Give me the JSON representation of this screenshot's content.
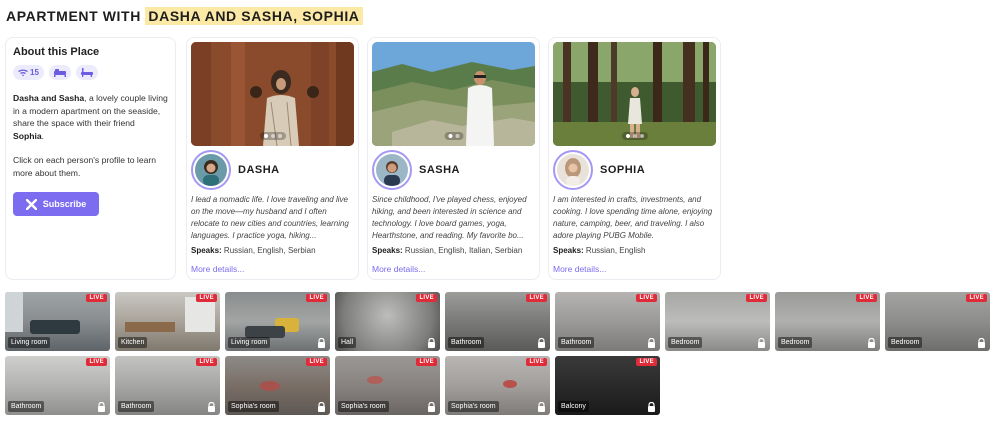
{
  "header": {
    "title_prefix": "APARTMENT WITH",
    "title_highlight": "DASHA AND SASHA, SOPHIA"
  },
  "about": {
    "heading": "About this Place",
    "amenities": [
      {
        "icon": "wifi-icon",
        "value": "15"
      },
      {
        "icon": "bed-icon",
        "value": ""
      },
      {
        "icon": "bathtub-icon",
        "value": ""
      }
    ],
    "desc_bold1": "Dasha and Sasha",
    "desc_mid": ", a lovely couple living in a modern apartment on the seaside, share the space with their friend ",
    "desc_bold2": "Sophia",
    "desc_end": ".",
    "hint": "Click on each person's profile to learn more about them.",
    "subscribe_label": "Subscribe",
    "accent": "#7b6cf0"
  },
  "profiles": [
    {
      "name": "DASHA",
      "bio": "I lead a nomadic life. I love traveling and live on the move—my husband and I often relocate to new cities and countries, learning languages. I practice yoga, hiking...",
      "speaks_label": "Speaks:",
      "speaks": "Russian, English, Serbian",
      "more": "More details...",
      "photo_dots": 3,
      "photo_active": 0
    },
    {
      "name": "SASHA",
      "bio": "Since childhood, I've played chess, enjoyed hiking, and been interested in science and technology. I love board games, yoga, Hearthstone, and reading. My favorite bo...",
      "speaks_label": "Speaks:",
      "speaks": "Russian, English, Italian, Serbian",
      "more": "More details...",
      "photo_dots": 2,
      "photo_active": 0
    },
    {
      "name": "SOPHIA",
      "bio": "I am interested in crafts, investments, and cooking. I love spending time alone, enjoying nature, camping, beer, and traveling. I also adore playing PUBG Mobile.",
      "speaks_label": "Speaks:",
      "speaks": "Russian, English",
      "more": "More details...",
      "photo_dots": 3,
      "photo_active": 0
    }
  ],
  "rooms": [
    {
      "label": "Living room",
      "badge": "LIVE",
      "locked": false
    },
    {
      "label": "Kitchen",
      "badge": "LIVE",
      "locked": false
    },
    {
      "label": "Living room",
      "badge": "LIVE",
      "locked": true
    },
    {
      "label": "Hall",
      "badge": "LIVE",
      "locked": true
    },
    {
      "label": "Bathroom",
      "badge": "LIVE",
      "locked": true
    },
    {
      "label": "Bathroom",
      "badge": "LIVE",
      "locked": true
    },
    {
      "label": "Bedroom",
      "badge": "LIVE",
      "locked": true
    },
    {
      "label": "Bedroom",
      "badge": "LIVE",
      "locked": true
    },
    {
      "label": "Bedroom",
      "badge": "LIVE",
      "locked": true
    },
    {
      "label": "Bathroom",
      "badge": "LIVE",
      "locked": true
    },
    {
      "label": "Bathroom",
      "badge": "LIVE",
      "locked": true
    },
    {
      "label": "Sophia's room",
      "badge": "LIVE",
      "locked": true
    },
    {
      "label": "Sophia's room",
      "badge": "LIVE",
      "locked": true
    },
    {
      "label": "Sophia's room",
      "badge": "LIVE",
      "locked": true
    },
    {
      "label": "Balcony",
      "badge": "LIVE",
      "locked": true
    }
  ]
}
